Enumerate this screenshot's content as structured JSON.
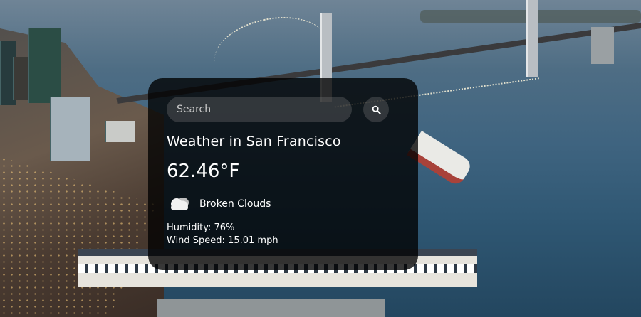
{
  "search": {
    "placeholder": "Search",
    "value": ""
  },
  "weather": {
    "title": "Weather in San Francisco",
    "temperature": "62.46°F",
    "condition": "Broken Clouds",
    "icon": "broken-clouds-icon",
    "humidity": "Humidity: 76%",
    "wind_speed": "Wind Speed: 15.01 mph"
  },
  "colors": {
    "card_background": "#000000",
    "text": "#ffffff",
    "input_background": "#7c7c7c"
  }
}
